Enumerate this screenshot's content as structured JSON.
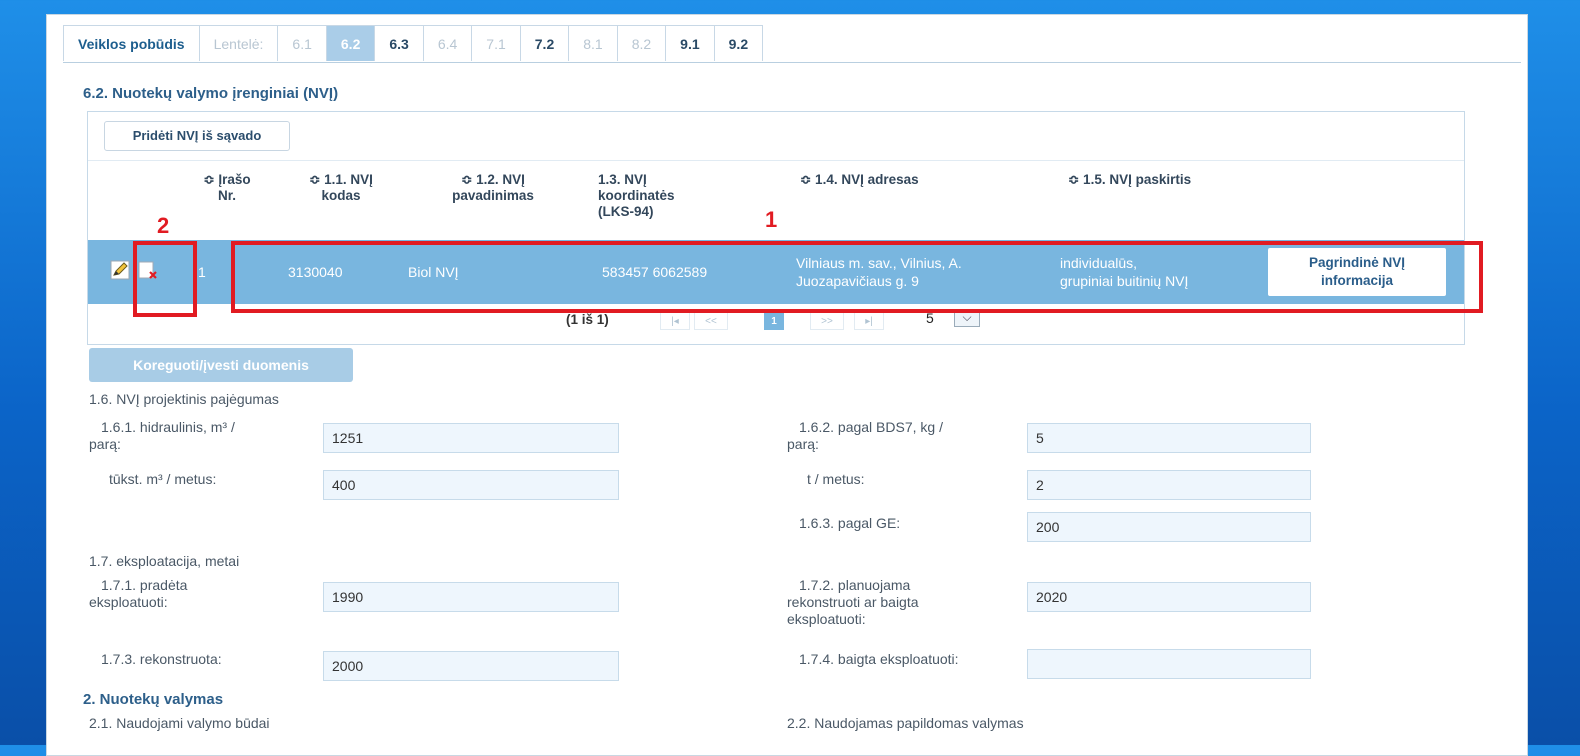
{
  "tabs": [
    {
      "label": "Veiklos pobūdis",
      "state": "first"
    },
    {
      "label": "Lentelė:",
      "state": "disabled"
    },
    {
      "label": "6.1",
      "state": "disabled"
    },
    {
      "label": "6.2",
      "state": "active"
    },
    {
      "label": "6.3",
      "state": "normal"
    },
    {
      "label": "6.4",
      "state": "disabled"
    },
    {
      "label": "7.1",
      "state": "disabled"
    },
    {
      "label": "7.2",
      "state": "normal"
    },
    {
      "label": "8.1",
      "state": "disabled"
    },
    {
      "label": "8.2",
      "state": "disabled"
    },
    {
      "label": "9.1",
      "state": "normal"
    },
    {
      "label": "9.2",
      "state": "normal"
    }
  ],
  "section_title": "6.2. Nuotekų valymo įrenginiai (NVĮ)",
  "add_button": "Pridėti NVĮ iš sąvado",
  "columns": {
    "c0": "≎ Įrašo\nNr.",
    "c1": "≎ 1.1. NVĮ\nkodas",
    "c2": "≎ 1.2. NVĮ\npavadinimas",
    "c3": "1.3. NVĮ\nkoordinatės\n(LKS-94)",
    "c4": "≎ 1.4. NVĮ adresas",
    "c5": "≎ 1.5. NVĮ paskirtis"
  },
  "row": {
    "nr": "1",
    "code": "3130040",
    "name": "Biol NVĮ",
    "coords": "583457 6062589",
    "address": "Vilniaus m. sav., Vilnius, A.\nJuozapavičiaus g. 9",
    "purpose": "individualūs,\ngrupiniai buitinių NVĮ",
    "info_button": "Pagrindinė NVĮ\ninformacija"
  },
  "pager": {
    "summary": "(1 iš 1)",
    "first": "|◂",
    "prev": "<<",
    "current": "1",
    "next": ">>",
    "last": "▸|",
    "page_size": "5"
  },
  "annotations": {
    "one": "1",
    "two": "2"
  },
  "edit_button": "Koreguoti/įvesti duomenis",
  "form": {
    "g16": "1.6. NVĮ projektinis pajėgumas",
    "l161": "1.6.1. hidraulinis, m³ /\nparą:",
    "v161": "1251",
    "l161b": "tūkst. m³ / metus:",
    "v161b": "400",
    "l162": "1.6.2. pagal BDS7, kg /\nparą:",
    "v162": "5",
    "l162b": "t / metus:",
    "v162b": "2",
    "l163": "1.6.3. pagal GE:",
    "v163": "200",
    "g17": "1.7. eksploatacija, metai",
    "l171": "1.7.1. pradėta\neksploatuoti:",
    "v171": "1990",
    "l172": "1.7.2. planuojama\nrekonstruoti ar baigta\neksploatuoti:",
    "v172": "2020",
    "l173": "1.7.3. rekonstruota:",
    "v173": "2000",
    "l174": "1.7.4. baigta eksploatuoti:",
    "v174": "",
    "s2": "2. Nuotekų valymas",
    "l21": "2.1. Naudojami valymo būdai",
    "l22": "2.2. Naudojamas papildomas valymas"
  }
}
